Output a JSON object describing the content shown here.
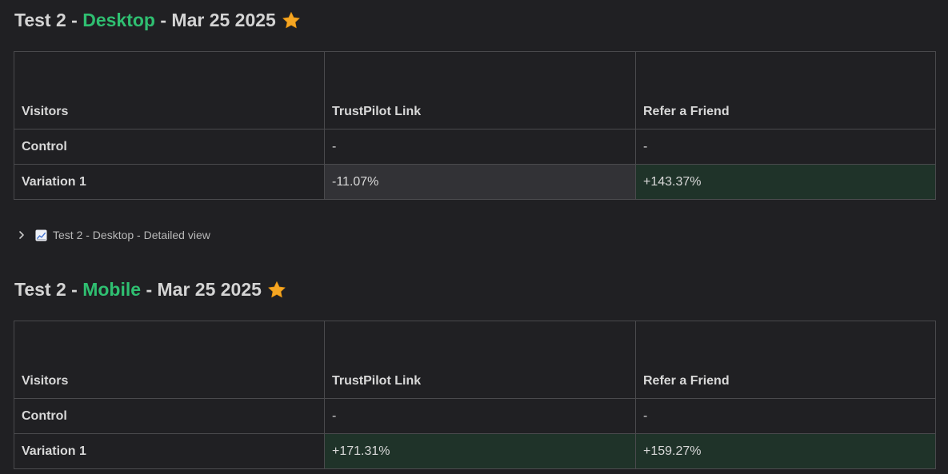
{
  "sections": [
    {
      "title_prefix": "Test 2 -",
      "title_accent": "Desktop",
      "title_suffix": "- Mar 25 2025",
      "icon": "star-icon",
      "table": {
        "headers": [
          "Visitors",
          "TrustPilot Link",
          "Refer a Friend"
        ],
        "rows": [
          {
            "label": "Control",
            "cells": [
              "-",
              "-"
            ]
          },
          {
            "label": "Variation 1",
            "cells": [
              "-11.07%",
              "+143.37%"
            ]
          }
        ]
      }
    },
    {
      "title_prefix": "Test 2 -",
      "title_accent": "Mobile",
      "title_suffix": "- Mar 25 2025",
      "icon": "star-icon",
      "table": {
        "headers": [
          "Visitors",
          "TrustPilot Link",
          "Refer a Friend"
        ],
        "rows": [
          {
            "label": "Control",
            "cells": [
              "-",
              "-"
            ]
          },
          {
            "label": "Variation 1",
            "cells": [
              "+171.31%",
              "+159.27%"
            ]
          }
        ]
      }
    }
  ],
  "toggle": {
    "label": "Test 2 - Desktop - Detailed view",
    "icons": [
      "chevron-right-icon",
      "chart-increasing-icon"
    ]
  },
  "colors": {
    "background": "#202023",
    "accent": "#2fbf71",
    "positive_cell": "#1f3329",
    "neutral_cell": "#323236",
    "border": "#4a4a4d",
    "star": "#f5a623"
  }
}
